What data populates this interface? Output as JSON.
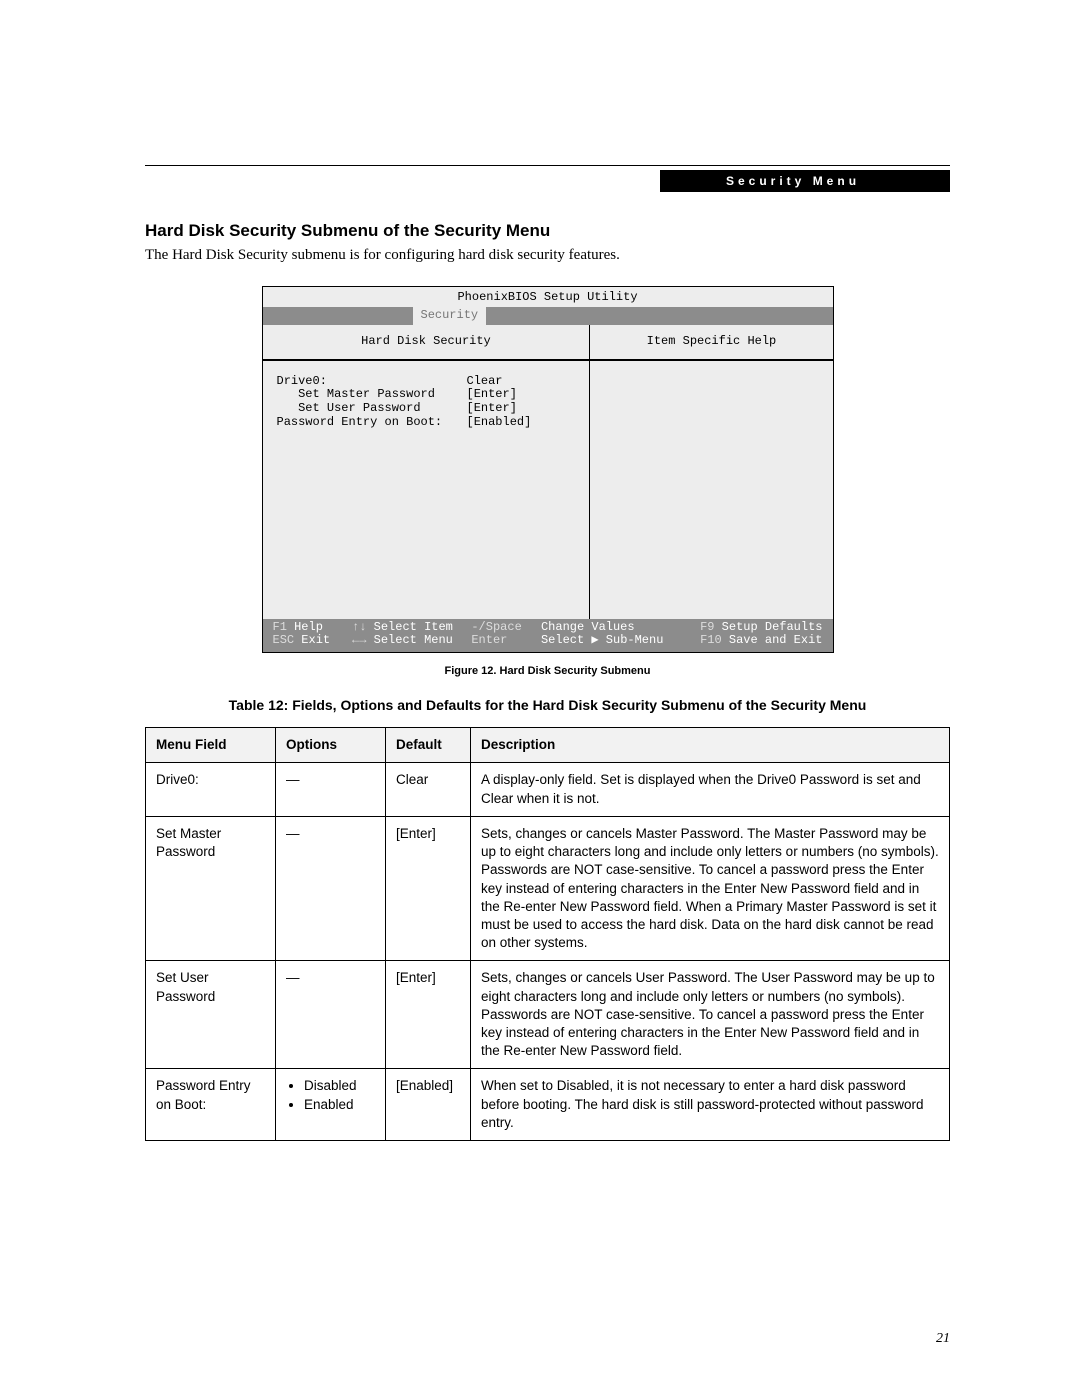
{
  "header_bar": "Security Menu",
  "section_title": "Hard Disk Security Submenu of the Security Menu",
  "intro": "The Hard Disk Security submenu is for configuring hard disk security features.",
  "bios": {
    "title": "PhoenixBIOS Setup Utility",
    "active_tab": "Security",
    "left_title": "Hard Disk Security",
    "right_title": "Item Specific Help",
    "lines": [
      {
        "label": "Drive0:",
        "value": "Clear"
      },
      {
        "label": "   Set Master Password",
        "value": "[Enter]"
      },
      {
        "label": "   Set User Password",
        "value": "[Enter]"
      },
      {
        "label": "",
        "value": ""
      },
      {
        "label": "Password Entry on Boot:",
        "value": "[Enabled]"
      }
    ],
    "footer_rows": [
      {
        "k1": "F1",
        "t1": "Help",
        "k2": "↑↓",
        "t2": "Select Item",
        "k3": "-/Space",
        "t3": "Change Values",
        "k4": "F9",
        "t4": "Setup Defaults"
      },
      {
        "k1": "ESC",
        "t1": "Exit",
        "k2": "←→",
        "t2": "Select Menu",
        "k3": "Enter",
        "t3": "Select ▶ Sub-Menu",
        "k4": "F10",
        "t4": "Save and Exit"
      }
    ]
  },
  "figure_caption": "Figure 12.  Hard Disk Security Submenu",
  "table_caption": "Table 12: Fields, Options and Defaults for the Hard Disk Security Submenu of the Security Menu",
  "table_headers": [
    "Menu Field",
    "Options",
    "Default",
    "Description"
  ],
  "table_rows": [
    {
      "field": "Drive0:",
      "options_dash": true,
      "default": "Clear",
      "desc": "A display-only field. Set is displayed when the Drive0 Password is set and Clear when it is not."
    },
    {
      "field": "Set Master Password",
      "options_dash": true,
      "default": "[Enter]",
      "desc": "Sets, changes or cancels Master Password. The Master Password may be up to eight characters long and include only letters or numbers (no symbols). Passwords are NOT case-sensitive. To cancel a password press the Enter key instead of entering characters in the Enter New Password field and in the Re-enter New Password field. When a Primary Master Password is set it must be used to access the hard disk. Data on the hard disk cannot be read on other systems."
    },
    {
      "field": "Set User Password",
      "options_dash": true,
      "default": "[Enter]",
      "desc": "Sets, changes or cancels User Password. The User Password may be up to eight characters long and include only letters or numbers (no symbols). Passwords are NOT case-sensitive. To cancel a password press the Enter key instead of entering characters in the Enter New Password field and in the Re-enter New Password field."
    },
    {
      "field": "Password Entry on Boot:",
      "options_list": [
        "Disabled",
        "Enabled"
      ],
      "default": "[Enabled]",
      "desc": "When set to Disabled, it is not necessary to enter a hard disk password before booting. The hard disk is still password-protected without password entry."
    }
  ],
  "page_number": "21"
}
